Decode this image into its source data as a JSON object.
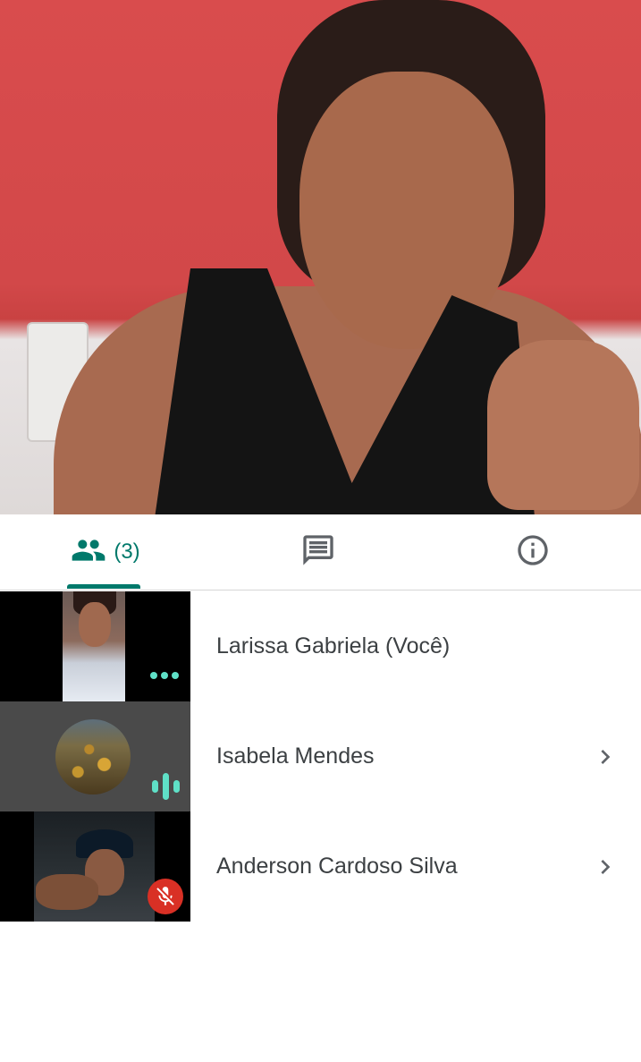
{
  "main_video": {
    "speaker": "Larissa Gabriela"
  },
  "tabs": {
    "people_count": "(3)",
    "people_icon": "people-icon",
    "chat_icon": "chat-icon",
    "info_icon": "info-icon",
    "active_tab": "people",
    "accent_color": "#00796b"
  },
  "participants": [
    {
      "name": "Larissa Gabriela (Você)",
      "status_icon": "more-dots-icon",
      "has_chevron": false
    },
    {
      "name": "Isabela Mendes",
      "status_icon": "speaking-icon",
      "has_chevron": true
    },
    {
      "name": "Anderson Cardoso Silva",
      "status_icon": "mic-off-icon",
      "has_chevron": true
    }
  ],
  "colors": {
    "indicator": "#5fe0c7",
    "muted": "#d93025",
    "text": "#3c4043"
  }
}
